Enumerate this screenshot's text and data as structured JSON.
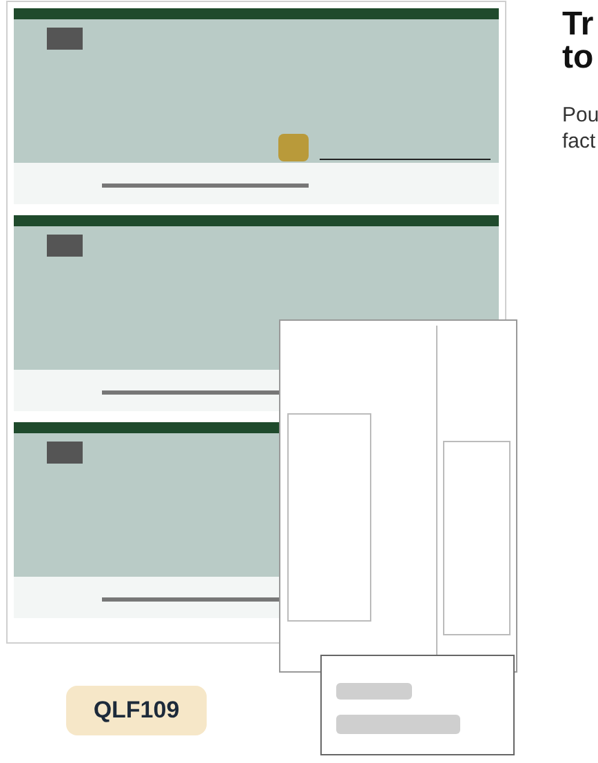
{
  "product": {
    "badge": "QLF109"
  },
  "heading_lines": [
    "Tr",
    "to"
  ],
  "description_lines": [
    "Pou",
    "fact"
  ]
}
